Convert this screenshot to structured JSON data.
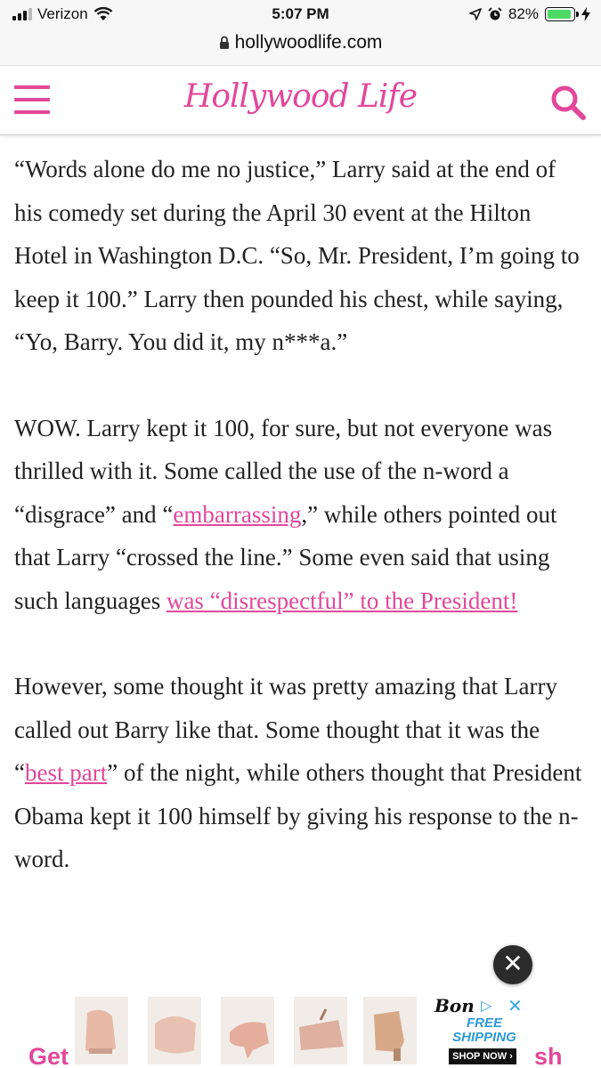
{
  "status_bar": {
    "carrier": "Verizon",
    "time": "5:07 PM",
    "battery": "82%",
    "battery_level": 0.82,
    "icons": [
      "signal-icon",
      "wifi-icon",
      "location-icon",
      "alarm-icon",
      "battery-icon",
      "charging-icon"
    ]
  },
  "url_bar": {
    "domain": "hollywoodlife.com"
  },
  "header": {
    "logo": "Hollywood Life",
    "accent_color": "#e2479a"
  },
  "article": {
    "p1": "“Words alone do me no justice,” Larry said at the end of his comedy set during the April 30 event at the Hilton Hotel in Washington D.C. “So, Mr. President, I’m going to keep it 100.” Larry then pounded his chest, while saying, “Yo, Barry. You did it, my n***a.”",
    "p2_a": "WOW. Larry kept it 100, for sure, but not everyone was thrilled with it. Some called the use of the n-word a “disgrace” and “",
    "p2_link1": "embarrassing",
    "p2_b": ",” while others pointed out that Larry “crossed the line.” Some even said that using such languages ",
    "p2_link2": "was “disrespectful” to the President!",
    "p3_a": "However, some thought it was pretty amazing that Larry called out Barry like that. Some thought that it was the “",
    "p3_link": "best part",
    "p3_b": "” of the night, while others thought that President Obama kept it 100 himself by giving his response to the n-word."
  },
  "ad": {
    "brand": "Bon",
    "adchoices": "▷",
    "close": "✕",
    "shipping": "FREE SHIPPING",
    "cta": "SHOP NOW ›"
  },
  "close_button": "✕",
  "bottom": {
    "left_fragment": "Get",
    "right_fragment": "sh"
  }
}
